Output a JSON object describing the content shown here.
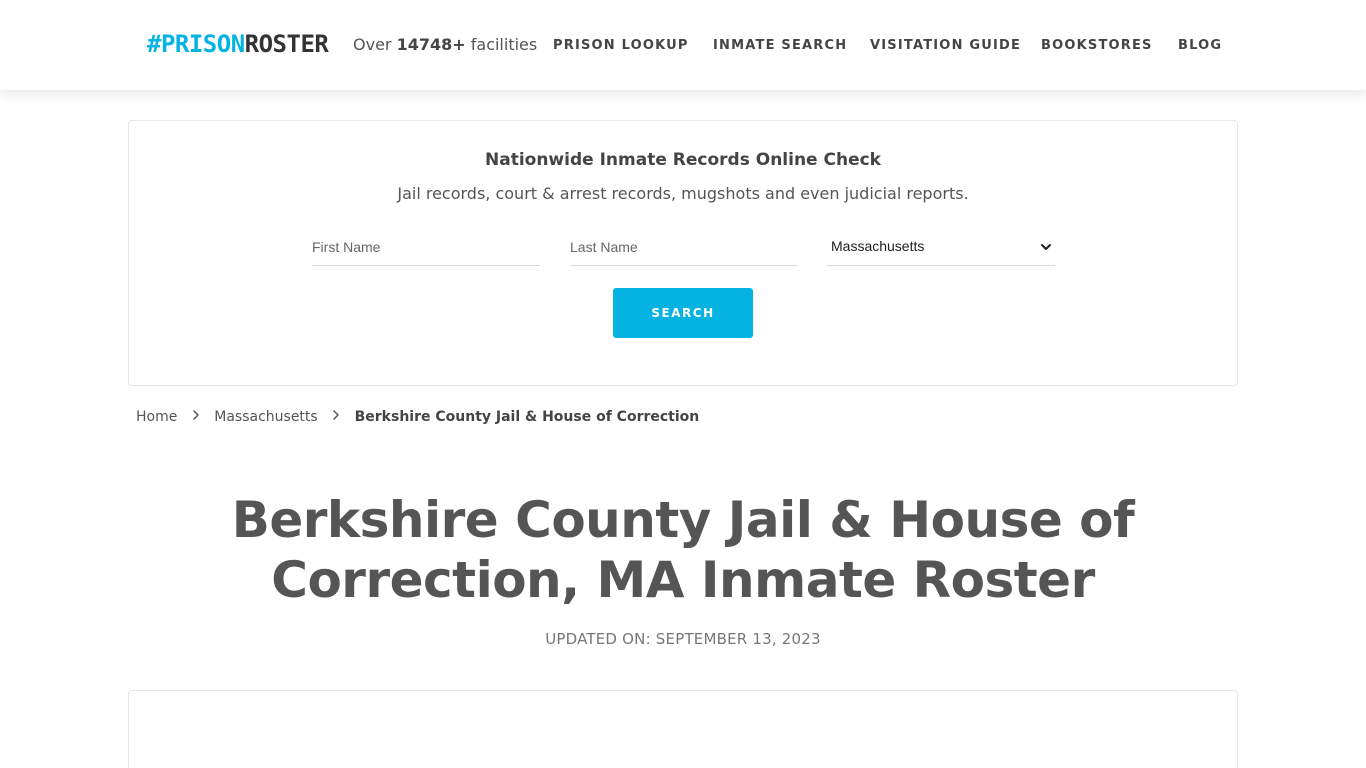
{
  "header": {
    "logo": {
      "hash": "#",
      "prison": "PRISON",
      "roster": "ROSTER"
    },
    "facilities": {
      "prefix": "Over",
      "count": "14748+",
      "suffix": "facilities"
    },
    "nav": [
      {
        "label": "PRISON LOOKUP"
      },
      {
        "label": "INMATE SEARCH"
      },
      {
        "label": "VISITATION GUIDE"
      },
      {
        "label": "BOOKSTORES"
      },
      {
        "label": "BLOG"
      }
    ]
  },
  "search": {
    "title": "Nationwide Inmate Records Online Check",
    "subtitle": "Jail records, court & arrest records, mugshots and even judicial reports.",
    "first_name_placeholder": "First Name",
    "last_name_placeholder": "Last Name",
    "state_selected": "Massachusetts",
    "button_label": "SEARCH"
  },
  "breadcrumb": {
    "home": "Home",
    "state": "Massachusetts",
    "current": "Berkshire County Jail & House of Correction"
  },
  "page": {
    "title": "Berkshire County Jail & House of Correction, MA Inmate Roster",
    "updated": "UPDATED ON: SEPTEMBER 13, 2023"
  },
  "colors": {
    "accent": "#05b3e2",
    "text": "#555555",
    "border": "#e6e6e6"
  }
}
